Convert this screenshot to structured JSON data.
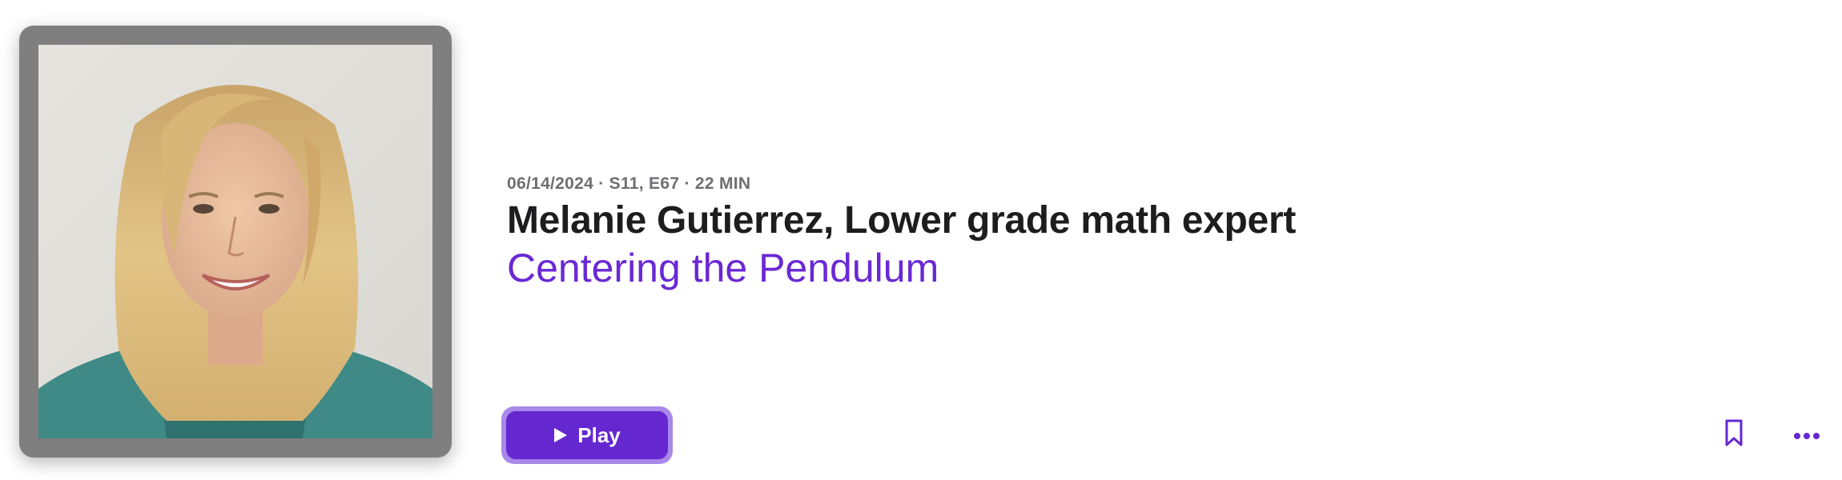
{
  "episode": {
    "meta": "06/14/2024 · S11, E67 · 22 MIN",
    "title": "Melanie Gutierrez, Lower grade math expert",
    "show_name": "Centering the Pendulum",
    "artwork_icon": "episode-artwork"
  },
  "actions": {
    "play_label": "Play",
    "play_icon": "play-icon",
    "bookmark_icon": "bookmark-icon",
    "more_icon": "ellipsis-icon"
  },
  "colors": {
    "accent": "#6527d0",
    "accent_ring": "#a888e8",
    "link": "#6a28d4",
    "title": "#1d1d1f",
    "meta": "#6e6e73",
    "artwork_frame": "#7f7f7f"
  }
}
